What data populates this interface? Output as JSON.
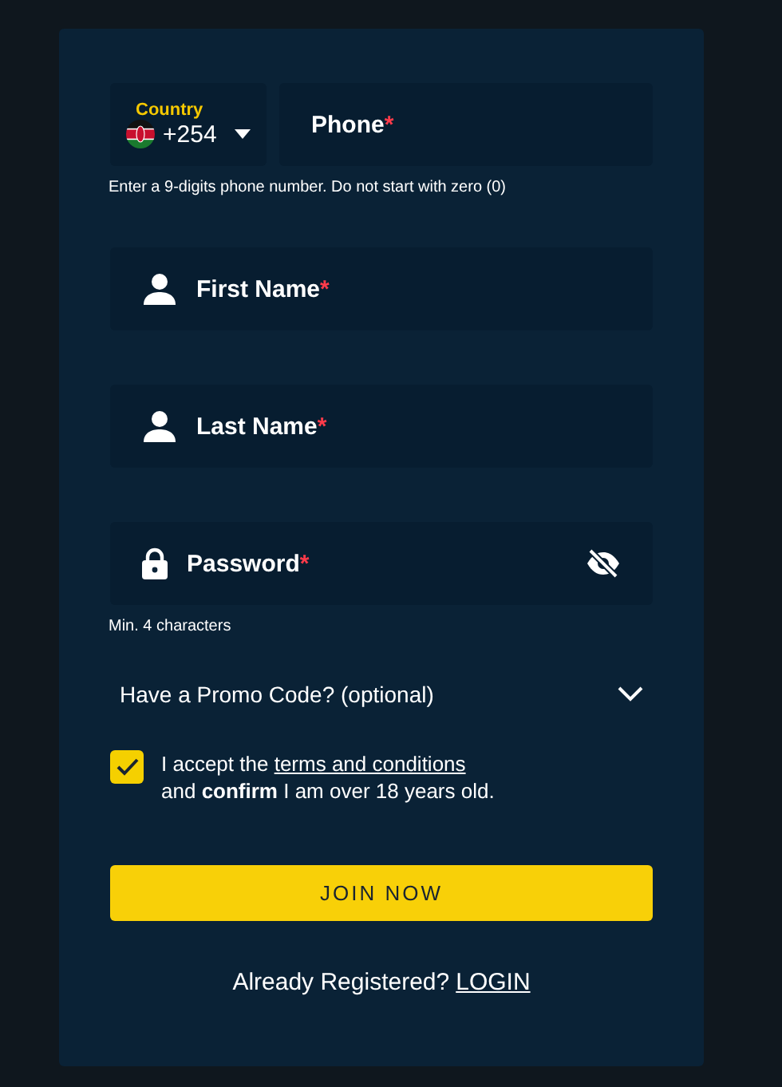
{
  "phone": {
    "country_label": "Country",
    "dial_code": "+254",
    "placeholder": "Phone",
    "required_mark": "*",
    "hint": "Enter a 9-digits phone number. Do not start with zero (0)"
  },
  "fields": [
    {
      "kind": "person",
      "placeholder": "First Name",
      "required_mark": "*"
    },
    {
      "kind": "person",
      "placeholder": "Last Name",
      "required_mark": "*"
    },
    {
      "kind": "password",
      "placeholder": "Password",
      "required_mark": "*",
      "hint": "Min. 4 characters"
    }
  ],
  "promo": {
    "label": "Have a Promo Code? (optional)",
    "expanded": false
  },
  "consent": {
    "checked": true,
    "before": "I accept the ",
    "link": "terms and conditions",
    "after": "and **confirm** I am over 18 years old."
  },
  "submit": "JOIN NOW",
  "login": {
    "text": "Already Registered?",
    "link": "LOGIN"
  }
}
